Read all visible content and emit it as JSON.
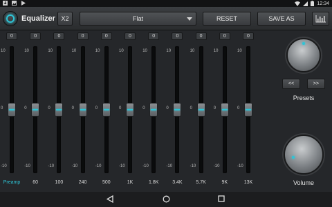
{
  "status_bar": {
    "time": "12:34"
  },
  "toolbar": {
    "title": "Equalizer",
    "x2_label": "X2",
    "preset_value": "Flat",
    "reset_label": "RESET",
    "save_as_label": "SAVE AS"
  },
  "scale": {
    "top": "10",
    "mid": "0",
    "bottom": "-10"
  },
  "bands": [
    {
      "label": "Preamp",
      "value": "0",
      "level": 0
    },
    {
      "label": "60",
      "value": "0",
      "level": 0
    },
    {
      "label": "100",
      "value": "0",
      "level": 0
    },
    {
      "label": "240",
      "value": "0",
      "level": 0
    },
    {
      "label": "500",
      "value": "0",
      "level": 0
    },
    {
      "label": "1K",
      "value": "0",
      "level": 0
    },
    {
      "label": "1.8K",
      "value": "0",
      "level": 0
    },
    {
      "label": "3.4K",
      "value": "0",
      "level": 0
    },
    {
      "label": "5.7K",
      "value": "0",
      "level": 0
    },
    {
      "label": "9K",
      "value": "0",
      "level": 0
    },
    {
      "label": "13K",
      "value": "0",
      "level": 0
    }
  ],
  "presets": {
    "prev_label": "<<",
    "next_label": ">>",
    "label": "Presets"
  },
  "volume": {
    "label": "Volume"
  },
  "colors": {
    "accent": "#2ec4d6",
    "background": "#25272a",
    "toolbar": "#3b3e41"
  },
  "icons": {
    "power": "power-icon",
    "graph": "equalizer-graph-icon",
    "back": "back-icon",
    "home": "home-icon",
    "recents": "recents-icon"
  }
}
